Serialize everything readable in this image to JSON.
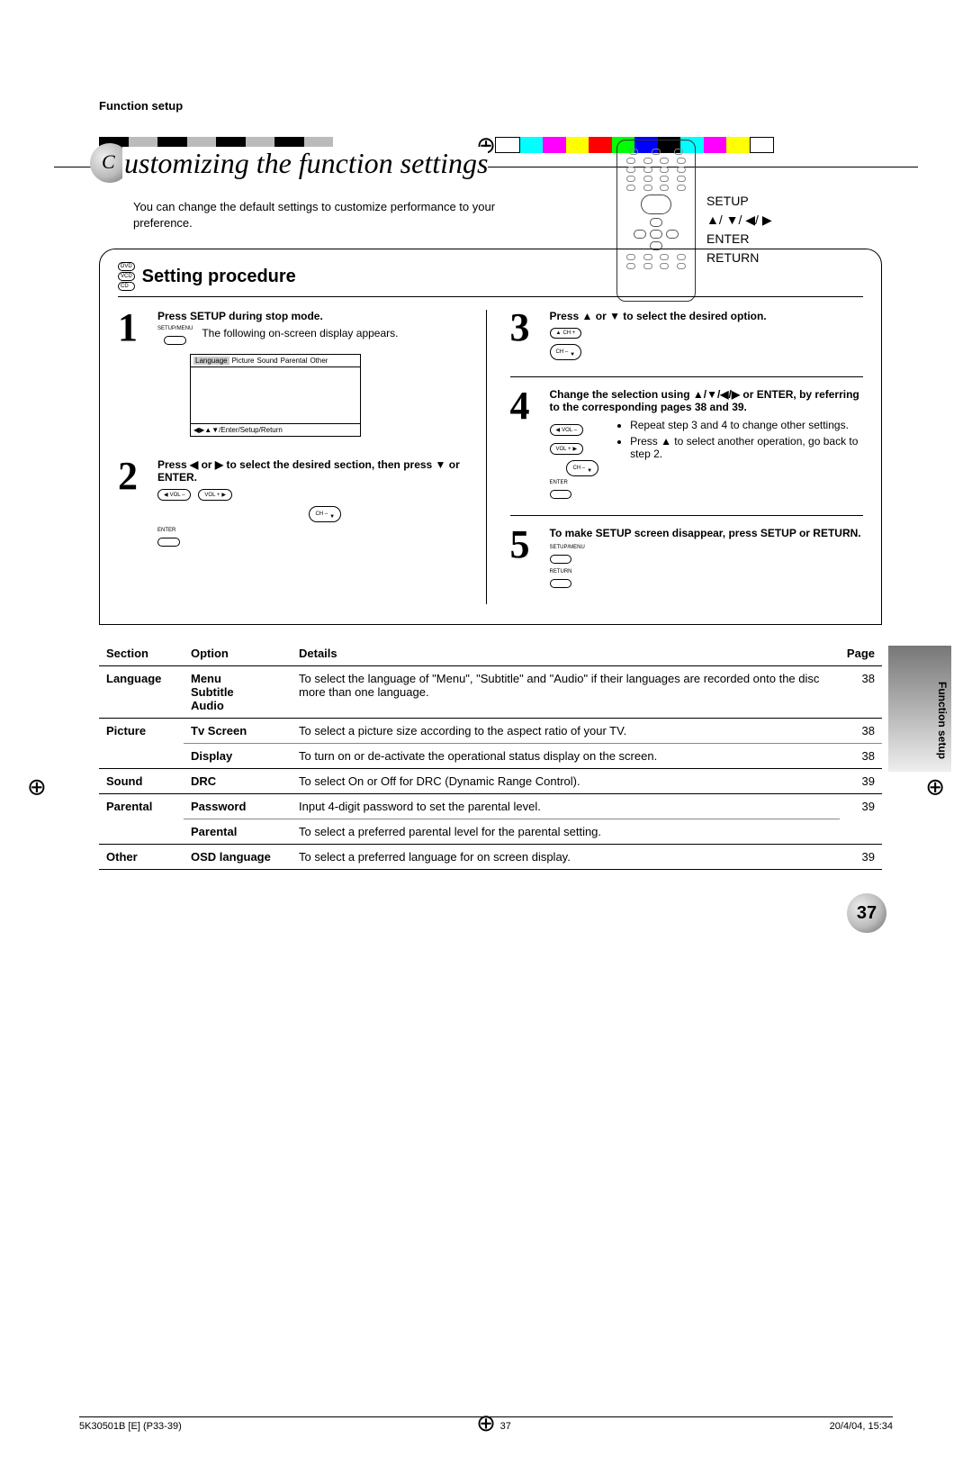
{
  "header_label": "Function setup",
  "title": "ustomizing the function settings",
  "intro": "You can change the default settings to customize performance to your preference.",
  "remote_labels": {
    "setup": "SETUP",
    "enter": "ENTER",
    "return": "RETURN"
  },
  "subtitle": "Setting procedure",
  "disc_tags": [
    "DVD",
    "VCD",
    "CD"
  ],
  "steps": {
    "s1": {
      "title": "Press SETUP during stop mode.",
      "text": "The following on-screen display appears.",
      "btn_label": "SETUP/MENU"
    },
    "osd": {
      "tabs": [
        "Language",
        "Picture",
        "Sound",
        "Parental",
        "Other"
      ],
      "footer": "◀▶▲▼/Enter/Setup/Return"
    },
    "s2": {
      "title": "Press ◀ or ▶ to select the desired section, then press ▼ or ENTER.",
      "labels": {
        "vol_minus": "VOL –",
        "vol_plus": "VOL +",
        "ch_minus": "CH –",
        "enter": "ENTER"
      }
    },
    "s3": {
      "title": "Press ▲ or ▼ to select the desired option.",
      "labels": {
        "ch_plus": "CH +",
        "ch_minus": "CH –"
      }
    },
    "s4": {
      "title": "Change the selection using ▲/▼/◀/▶ or ENTER, by referring to the corresponding pages 38 and 39.",
      "bullets": [
        "Repeat step 3 and 4 to change other settings.",
        "Press ▲ to select another operation, go back to step 2."
      ],
      "labels": {
        "vol_minus": "VOL –",
        "vol_plus": "VOL +",
        "ch_minus": "CH –",
        "enter": "ENTER"
      }
    },
    "s5": {
      "title": "To make SETUP screen disappear, press SETUP or RETURN.",
      "labels": {
        "setup": "SETUP/MENU",
        "return": "RETURN"
      }
    }
  },
  "side_tab": "Function setup",
  "table": {
    "headers": {
      "section": "Section",
      "option": "Option",
      "details": "Details",
      "page": "Page"
    },
    "rows": [
      {
        "section": "Language",
        "option_stack": [
          "Menu",
          "Subtitle",
          "Audio"
        ],
        "details": "To select the language of \"Menu\", \"Subtitle\" and \"Audio\" if their languages are recorded onto the disc more than one language.",
        "page": "38"
      },
      {
        "section": "Picture",
        "option": "Tv Screen",
        "details": "To select a picture size according to the aspect ratio of your TV.",
        "page": "38",
        "section_rowspan": 2,
        "thin": true
      },
      {
        "option": "Display",
        "details": "To turn on or de-activate the operational status display on the screen.",
        "page": "38"
      },
      {
        "section": "Sound",
        "option": "DRC",
        "details": "To select On or Off for DRC (Dynamic Range Control).",
        "page": "39"
      },
      {
        "section": "Parental",
        "option": "Password",
        "details": "Input 4-digit password to set the parental level.",
        "page": "39",
        "section_rowspan": 2,
        "page_rowspan": 2,
        "thin": true
      },
      {
        "option": "Parental",
        "details": "To select a preferred parental level for the parental setting."
      },
      {
        "section": "Other",
        "option": "OSD language",
        "details": "To select a preferred language for on screen display.",
        "page": "39"
      }
    ]
  },
  "page_number": "37",
  "footer": {
    "left": "5K30501B [E] (P33-39)",
    "center": "37",
    "right": "20/4/04, 15:34"
  }
}
